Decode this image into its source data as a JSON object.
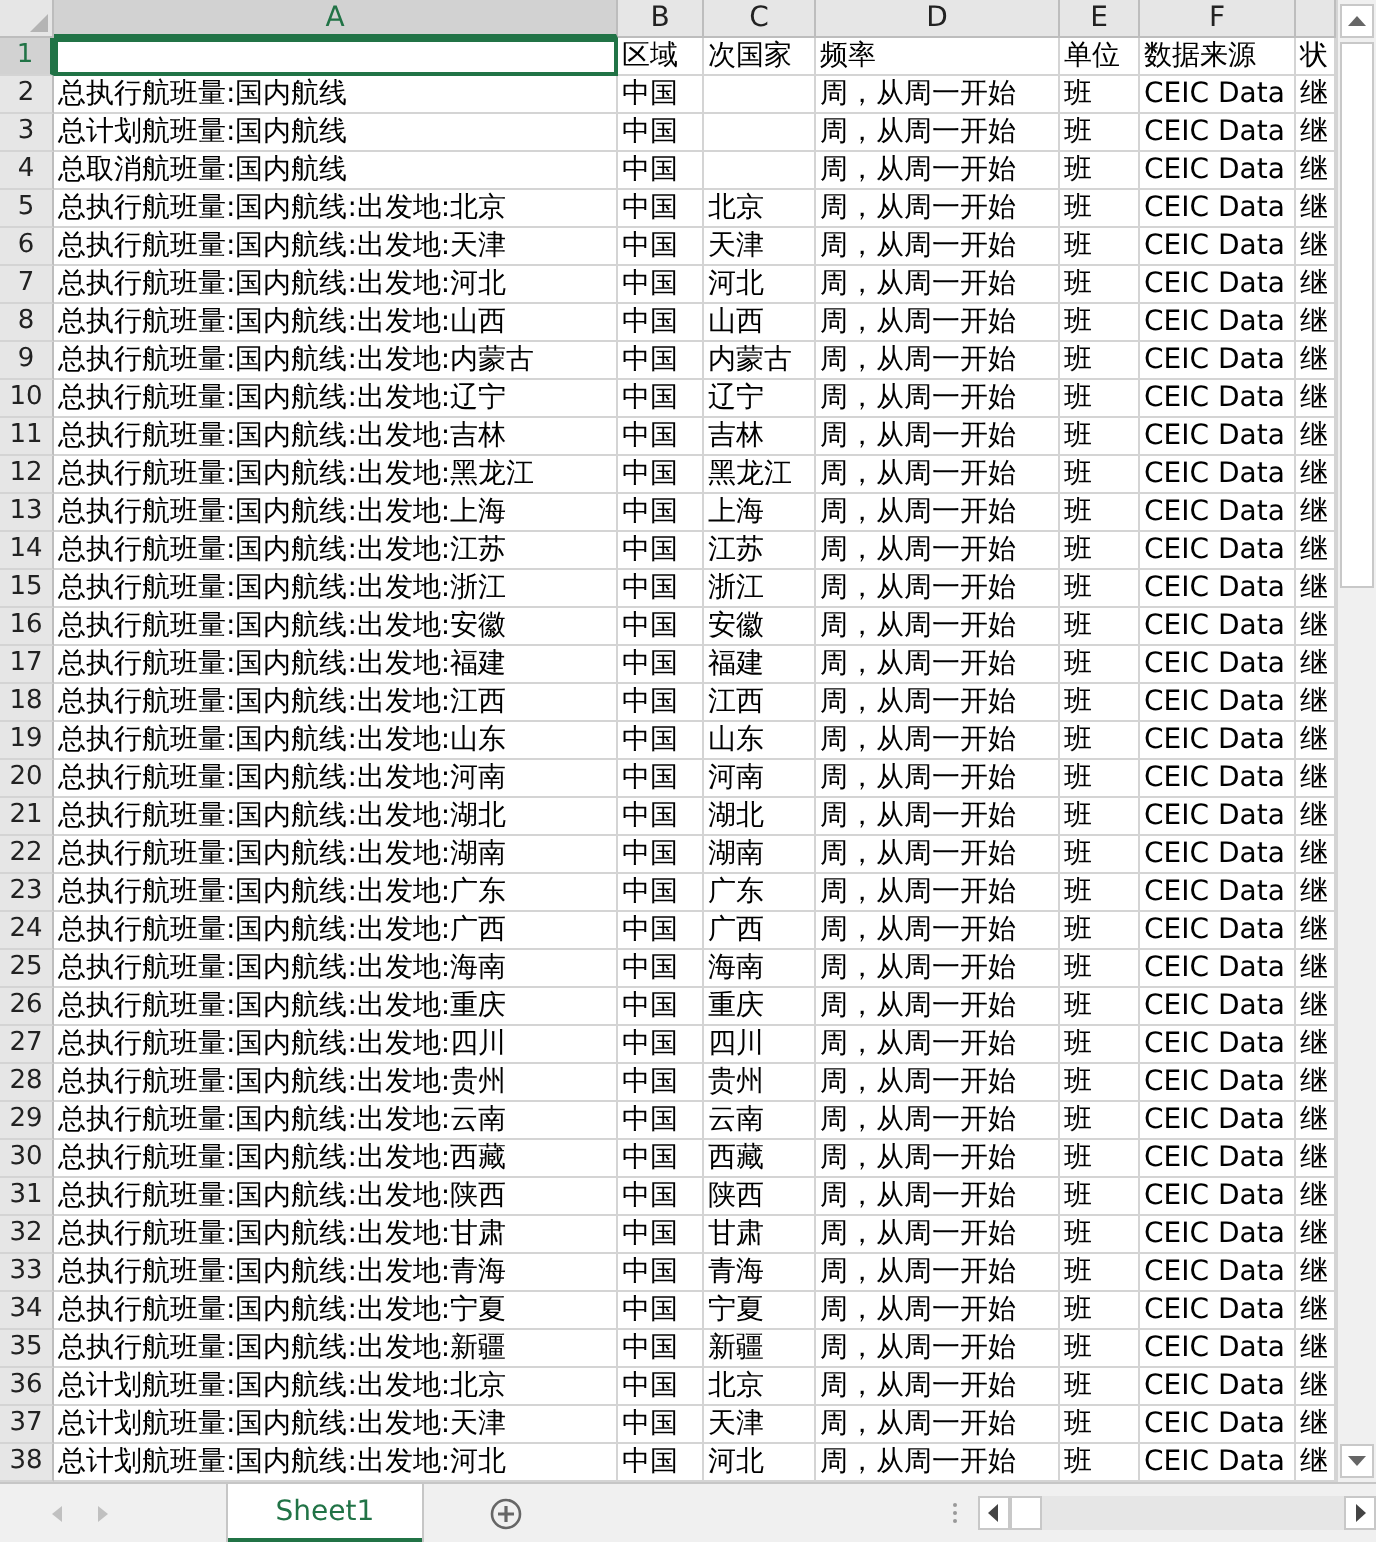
{
  "columns": [
    {
      "label": "A",
      "selected": true
    },
    {
      "label": "B",
      "selected": false
    },
    {
      "label": "C",
      "selected": false
    },
    {
      "label": "D",
      "selected": false
    },
    {
      "label": "E",
      "selected": false
    },
    {
      "label": "F",
      "selected": false
    }
  ],
  "rows": [
    {
      "num": "1",
      "selected": true,
      "cells": [
        null,
        "区域",
        "次国家",
        "频率",
        "单位",
        "数据来源",
        "状"
      ]
    },
    {
      "num": "2",
      "selected": false,
      "cells": [
        "总执行航班量:国内航线",
        "中国",
        null,
        "周，从周一开始",
        "班",
        "CEIC Data",
        "继"
      ]
    },
    {
      "num": "3",
      "selected": false,
      "cells": [
        "总计划航班量:国内航线",
        "中国",
        null,
        "周，从周一开始",
        "班",
        "CEIC Data",
        "继"
      ]
    },
    {
      "num": "4",
      "selected": false,
      "cells": [
        "总取消航班量:国内航线",
        "中国",
        null,
        "周，从周一开始",
        "班",
        "CEIC Data",
        "继"
      ]
    },
    {
      "num": "5",
      "selected": false,
      "cells": [
        "总执行航班量:国内航线:出发地:北京",
        "中国",
        "北京",
        "周，从周一开始",
        "班",
        "CEIC Data",
        "继"
      ]
    },
    {
      "num": "6",
      "selected": false,
      "cells": [
        "总执行航班量:国内航线:出发地:天津",
        "中国",
        "天津",
        "周，从周一开始",
        "班",
        "CEIC Data",
        "继"
      ]
    },
    {
      "num": "7",
      "selected": false,
      "cells": [
        "总执行航班量:国内航线:出发地:河北",
        "中国",
        "河北",
        "周，从周一开始",
        "班",
        "CEIC Data",
        "继"
      ]
    },
    {
      "num": "8",
      "selected": false,
      "cells": [
        "总执行航班量:国内航线:出发地:山西",
        "中国",
        "山西",
        "周，从周一开始",
        "班",
        "CEIC Data",
        "继"
      ]
    },
    {
      "num": "9",
      "selected": false,
      "cells": [
        "总执行航班量:国内航线:出发地:内蒙古",
        "中国",
        "内蒙古",
        "周，从周一开始",
        "班",
        "CEIC Data",
        "继"
      ]
    },
    {
      "num": "10",
      "selected": false,
      "cells": [
        "总执行航班量:国内航线:出发地:辽宁",
        "中国",
        "辽宁",
        "周，从周一开始",
        "班",
        "CEIC Data",
        "继"
      ]
    },
    {
      "num": "11",
      "selected": false,
      "cells": [
        "总执行航班量:国内航线:出发地:吉林",
        "中国",
        "吉林",
        "周，从周一开始",
        "班",
        "CEIC Data",
        "继"
      ]
    },
    {
      "num": "12",
      "selected": false,
      "cells": [
        "总执行航班量:国内航线:出发地:黑龙江",
        "中国",
        "黑龙江",
        "周，从周一开始",
        "班",
        "CEIC Data",
        "继"
      ]
    },
    {
      "num": "13",
      "selected": false,
      "cells": [
        "总执行航班量:国内航线:出发地:上海",
        "中国",
        "上海",
        "周，从周一开始",
        "班",
        "CEIC Data",
        "继"
      ]
    },
    {
      "num": "14",
      "selected": false,
      "cells": [
        "总执行航班量:国内航线:出发地:江苏",
        "中国",
        "江苏",
        "周，从周一开始",
        "班",
        "CEIC Data",
        "继"
      ]
    },
    {
      "num": "15",
      "selected": false,
      "cells": [
        "总执行航班量:国内航线:出发地:浙江",
        "中国",
        "浙江",
        "周，从周一开始",
        "班",
        "CEIC Data",
        "继"
      ]
    },
    {
      "num": "16",
      "selected": false,
      "cells": [
        "总执行航班量:国内航线:出发地:安徽",
        "中国",
        "安徽",
        "周，从周一开始",
        "班",
        "CEIC Data",
        "继"
      ]
    },
    {
      "num": "17",
      "selected": false,
      "cells": [
        "总执行航班量:国内航线:出发地:福建",
        "中国",
        "福建",
        "周，从周一开始",
        "班",
        "CEIC Data",
        "继"
      ]
    },
    {
      "num": "18",
      "selected": false,
      "cells": [
        "总执行航班量:国内航线:出发地:江西",
        "中国",
        "江西",
        "周，从周一开始",
        "班",
        "CEIC Data",
        "继"
      ]
    },
    {
      "num": "19",
      "selected": false,
      "cells": [
        "总执行航班量:国内航线:出发地:山东",
        "中国",
        "山东",
        "周，从周一开始",
        "班",
        "CEIC Data",
        "继"
      ]
    },
    {
      "num": "20",
      "selected": false,
      "cells": [
        "总执行航班量:国内航线:出发地:河南",
        "中国",
        "河南",
        "周，从周一开始",
        "班",
        "CEIC Data",
        "继"
      ]
    },
    {
      "num": "21",
      "selected": false,
      "cells": [
        "总执行航班量:国内航线:出发地:湖北",
        "中国",
        "湖北",
        "周，从周一开始",
        "班",
        "CEIC Data",
        "继"
      ]
    },
    {
      "num": "22",
      "selected": false,
      "cells": [
        "总执行航班量:国内航线:出发地:湖南",
        "中国",
        "湖南",
        "周，从周一开始",
        "班",
        "CEIC Data",
        "继"
      ]
    },
    {
      "num": "23",
      "selected": false,
      "cells": [
        "总执行航班量:国内航线:出发地:广东",
        "中国",
        "广东",
        "周，从周一开始",
        "班",
        "CEIC Data",
        "继"
      ]
    },
    {
      "num": "24",
      "selected": false,
      "cells": [
        "总执行航班量:国内航线:出发地:广西",
        "中国",
        "广西",
        "周，从周一开始",
        "班",
        "CEIC Data",
        "继"
      ]
    },
    {
      "num": "25",
      "selected": false,
      "cells": [
        "总执行航班量:国内航线:出发地:海南",
        "中国",
        "海南",
        "周，从周一开始",
        "班",
        "CEIC Data",
        "继"
      ]
    },
    {
      "num": "26",
      "selected": false,
      "cells": [
        "总执行航班量:国内航线:出发地:重庆",
        "中国",
        "重庆",
        "周，从周一开始",
        "班",
        "CEIC Data",
        "继"
      ]
    },
    {
      "num": "27",
      "selected": false,
      "cells": [
        "总执行航班量:国内航线:出发地:四川",
        "中国",
        "四川",
        "周，从周一开始",
        "班",
        "CEIC Data",
        "继"
      ]
    },
    {
      "num": "28",
      "selected": false,
      "cells": [
        "总执行航班量:国内航线:出发地:贵州",
        "中国",
        "贵州",
        "周，从周一开始",
        "班",
        "CEIC Data",
        "继"
      ]
    },
    {
      "num": "29",
      "selected": false,
      "cells": [
        "总执行航班量:国内航线:出发地:云南",
        "中国",
        "云南",
        "周，从周一开始",
        "班",
        "CEIC Data",
        "继"
      ]
    },
    {
      "num": "30",
      "selected": false,
      "cells": [
        "总执行航班量:国内航线:出发地:西藏",
        "中国",
        "西藏",
        "周，从周一开始",
        "班",
        "CEIC Data",
        "继"
      ]
    },
    {
      "num": "31",
      "selected": false,
      "cells": [
        "总执行航班量:国内航线:出发地:陕西",
        "中国",
        "陕西",
        "周，从周一开始",
        "班",
        "CEIC Data",
        "继"
      ]
    },
    {
      "num": "32",
      "selected": false,
      "cells": [
        "总执行航班量:国内航线:出发地:甘肃",
        "中国",
        "甘肃",
        "周，从周一开始",
        "班",
        "CEIC Data",
        "继"
      ]
    },
    {
      "num": "33",
      "selected": false,
      "cells": [
        "总执行航班量:国内航线:出发地:青海",
        "中国",
        "青海",
        "周，从周一开始",
        "班",
        "CEIC Data",
        "继"
      ]
    },
    {
      "num": "34",
      "selected": false,
      "cells": [
        "总执行航班量:国内航线:出发地:宁夏",
        "中国",
        "宁夏",
        "周，从周一开始",
        "班",
        "CEIC Data",
        "继"
      ]
    },
    {
      "num": "35",
      "selected": false,
      "cells": [
        "总执行航班量:国内航线:出发地:新疆",
        "中国",
        "新疆",
        "周，从周一开始",
        "班",
        "CEIC Data",
        "继"
      ]
    },
    {
      "num": "36",
      "selected": false,
      "cells": [
        "总计划航班量:国内航线:出发地:北京",
        "中国",
        "北京",
        "周，从周一开始",
        "班",
        "CEIC Data",
        "继"
      ]
    },
    {
      "num": "37",
      "selected": false,
      "cells": [
        "总计划航班量:国内航线:出发地:天津",
        "中国",
        "天津",
        "周，从周一开始",
        "班",
        "CEIC Data",
        "继"
      ]
    },
    {
      "num": "38",
      "selected": false,
      "cells": [
        "总计划航班量:国内航线:出发地:河北",
        "中国",
        "河北",
        "周，从周一开始",
        "班",
        "CEIC Data",
        "继"
      ]
    }
  ],
  "sheet_tabs": [
    {
      "label": "Sheet1",
      "selected": true
    }
  ]
}
